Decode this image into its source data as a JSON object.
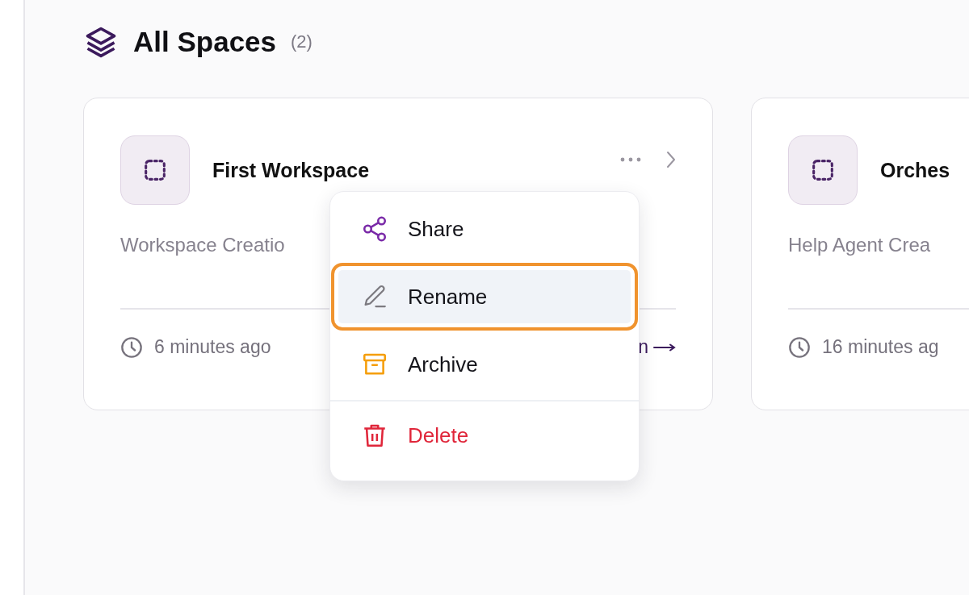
{
  "heading": {
    "title": "All Spaces",
    "count": "(2)"
  },
  "spaces": [
    {
      "title": "First Workspace",
      "description": "Workspace Creatio",
      "time": "6 minutes ago",
      "link": "n"
    },
    {
      "title": "Orches",
      "description": "Help Agent Crea",
      "time": "16 minutes ag"
    }
  ],
  "context_menu": {
    "items": [
      {
        "label": "Share",
        "kind": "share",
        "selected": false
      },
      {
        "label": "Rename",
        "kind": "rename",
        "selected": true
      },
      {
        "label": "Archive",
        "kind": "archive",
        "selected": false
      },
      {
        "label": "Delete",
        "kind": "delete",
        "selected": false
      }
    ]
  }
}
